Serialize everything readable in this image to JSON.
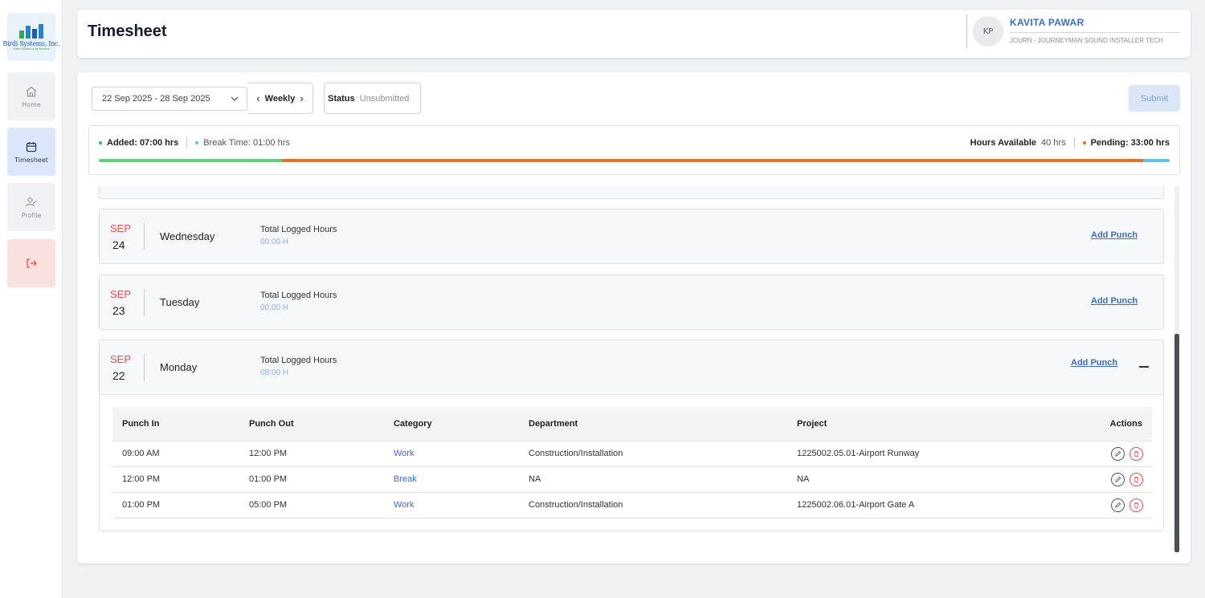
{
  "brand": {
    "logo_text": "Birdi Systems, Inc.",
    "logo_tagline": "From Solutions to Service"
  },
  "sidebar": {
    "items": [
      {
        "label": "Home",
        "icon": "home-icon"
      },
      {
        "label": "Timesheet",
        "icon": "calendar-icon",
        "active": true
      },
      {
        "label": "Profile",
        "icon": "profile-icon"
      },
      {
        "label": "",
        "icon": "logout-icon"
      }
    ]
  },
  "header": {
    "title": "Timesheet",
    "user": {
      "initials": "KP",
      "name": "KAVITA PAWAR",
      "role": "JOURN - JOURNEYMAN SOUND INSTALLER TECH"
    }
  },
  "toolbar": {
    "date_range": "22 Sep 2025 - 28 Sep 2025",
    "period": "Weekly",
    "status_label": "Status",
    "status_value": "Unsubmitted",
    "submit_label": "Submit"
  },
  "summary": {
    "added_label": "Added: 07:00 hrs",
    "break_label": "Break Time: 01:00 hrs",
    "hours_available_label": "Hours Available",
    "hours_available_value": "40 hrs",
    "pending_label": "Pending: 33:00 hrs",
    "progress": {
      "added": 0.175,
      "pending": 0.825,
      "break": 0.025
    },
    "colors": {
      "added": "#5fd07a",
      "pending": "#e2742a",
      "break": "#5ec4ef"
    }
  },
  "days": [
    {
      "month": "SEP",
      "day": "24",
      "weekday": "Wednesday",
      "logged_label": "Total Logged Hours",
      "logged_value": "00:00 H",
      "add_punch": "Add Punch"
    },
    {
      "month": "SEP",
      "day": "23",
      "weekday": "Tuesday",
      "logged_label": "Total Logged Hours",
      "logged_value": "00:00 H",
      "add_punch": "Add Punch"
    },
    {
      "month": "SEP",
      "day": "22",
      "weekday": "Monday",
      "logged_label": "Total Logged Hours",
      "logged_value": "08:00 H",
      "add_punch": "Add Punch",
      "expanded": true
    }
  ],
  "punch_table": {
    "columns": [
      "Punch In",
      "Punch Out",
      "Category",
      "Department",
      "Project",
      "Actions"
    ],
    "rows": [
      {
        "punch_in": "09:00 AM",
        "punch_out": "12:00 PM",
        "category": "Work",
        "department": "Construction/Installation",
        "project": "1225002.05.01-Airport Runway"
      },
      {
        "punch_in": "12:00 PM",
        "punch_out": "01:00 PM",
        "category": "Break",
        "department": "NA",
        "project": "NA"
      },
      {
        "punch_in": "01:00 PM",
        "punch_out": "05:00 PM",
        "category": "Work",
        "department": "Construction/Installation",
        "project": "1225002.06.01-Airport Gate A"
      }
    ]
  }
}
